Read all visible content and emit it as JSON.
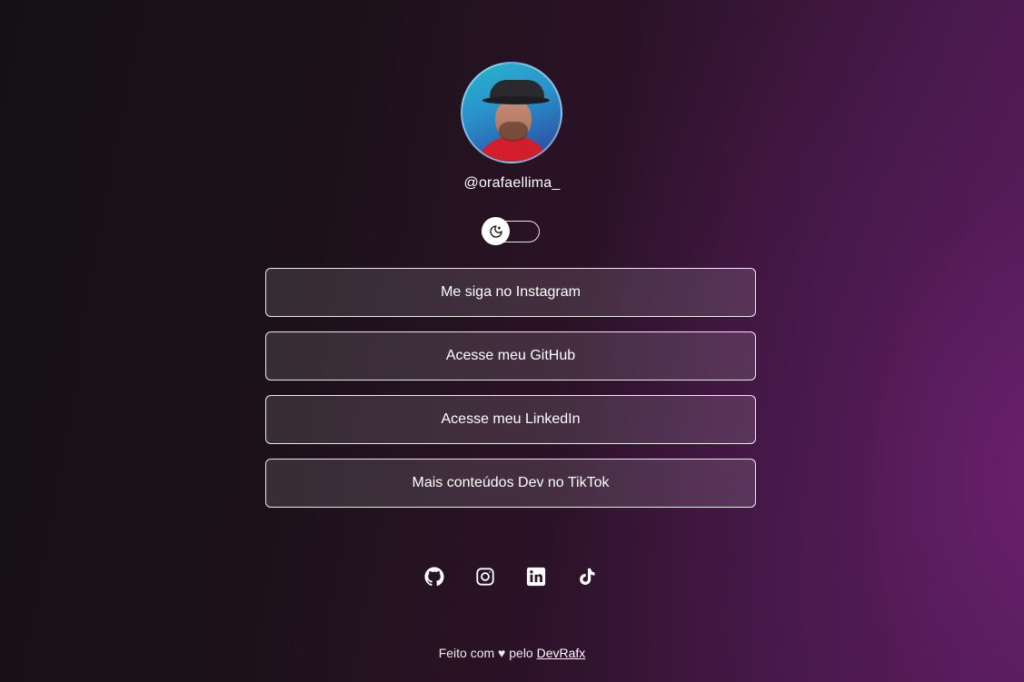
{
  "profile": {
    "username": "@orafaellima_"
  },
  "theme_toggle": {
    "icon": "moon-icon",
    "state": "off"
  },
  "links": [
    {
      "label": "Me siga no Instagram"
    },
    {
      "label": "Acesse meu GitHub"
    },
    {
      "label": "Acesse meu LinkedIn"
    },
    {
      "label": "Mais conteúdos Dev no TikTok"
    }
  ],
  "socials": [
    {
      "icon": "github-icon"
    },
    {
      "icon": "instagram-icon"
    },
    {
      "icon": "linkedin-icon"
    },
    {
      "icon": "tiktok-icon"
    }
  ],
  "footer": {
    "prefix": "Feito com ♥ pelo",
    "author_link": "DevRafx"
  },
  "colors": {
    "text": "#ffffff",
    "background_start": "#141116",
    "background_end": "#561d5a"
  }
}
